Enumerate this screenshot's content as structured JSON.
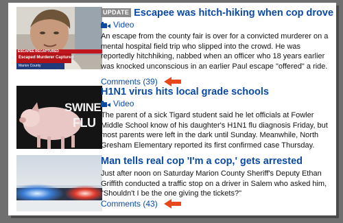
{
  "stories": [
    {
      "badge": "UPDATE",
      "headline": "Escapee was hitch-hiking when cop drove by",
      "video_label": "Video",
      "description": "An escape from the county fair is over for a convicted murderer on a mental hospital field trip who slipped into the crowd. He was reportedly hitchhiking, nabbed when an officer who 18 years earlier was knocked unconscious in an earlier Paul escape \"offered\" a ride.",
      "comments": "Comments (39)",
      "thumb_caption_1": "ESCAPEE RECAPTURED",
      "thumb_caption_2": "Escaped Murderer Captured",
      "thumb_caption_3": "Marion County"
    },
    {
      "headline": "H1N1 virus hits local grade schools",
      "video_label": "Video",
      "description": "The parent of a sick Tigard student said he let officials at Fowler Middle School know of his daughter's H1N1 flu diagnosis Friday, but most parents were left in the dark until Sunday. Meanwhile, North Gresham Elementary reported its first confirmed case Thursday.",
      "thumb_text_1": "SWINE",
      "thumb_text_2": "FLU"
    },
    {
      "headline": "Man tells real cop 'I'm a cop,' gets arrested",
      "description": "Just after noon on Saturday Marion County Sheriff's Deputy Ethan Griffith conducted a traffic stop on a driver in Salem who asked him, \"Shouldn't I be the one giving the tickets?\"",
      "comments": "Comments (43)"
    }
  ],
  "colors": {
    "link": "#0a4aa6",
    "arrow": "#e8471c"
  },
  "icons": [
    "video-camera-icon",
    "red-arrow-icon"
  ]
}
